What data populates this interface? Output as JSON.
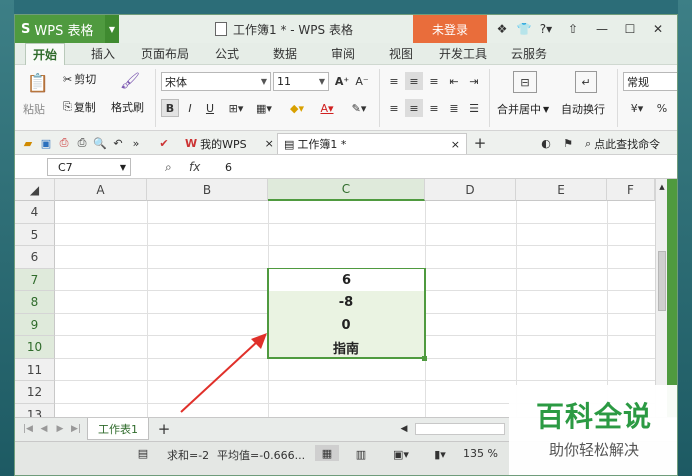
{
  "app": {
    "name": "WPS 表格",
    "logo": "S"
  },
  "title": "工作簿1 * - WPS 表格",
  "login": "未登录",
  "menu_tabs": [
    "开始",
    "插入",
    "页面布局",
    "公式",
    "数据",
    "审阅",
    "视图",
    "开发工具",
    "云服务"
  ],
  "ribbon": {
    "paste": "粘贴",
    "cut": "剪切",
    "copy": "复制",
    "format_painter": "格式刷",
    "font": "宋体",
    "font_size": "11",
    "merge_center": "合并居中",
    "wrap_text": "自动换行",
    "number_format": "常规",
    "percent": "%"
  },
  "doc_tabs": {
    "mywps": "我的WPS",
    "book": "工作簿1 *",
    "search": "点此查找命令"
  },
  "formula_bar": {
    "cell_ref": "C7",
    "fx": "fx",
    "value": "6"
  },
  "columns": [
    "A",
    "B",
    "C",
    "D",
    "E",
    "F"
  ],
  "rows": [
    "4",
    "5",
    "6",
    "7",
    "8",
    "9",
    "10",
    "11",
    "12",
    "13"
  ],
  "cells": {
    "c7": "6",
    "c8": "-8",
    "c9": "0",
    "c10": "指南"
  },
  "sheet_tab": "工作表1",
  "status": {
    "sum": "求和=-2",
    "avg": "平均值=-0.666...",
    "zoom": "135 %"
  },
  "watermark": {
    "title": "百科全说",
    "subtitle": "助你轻松解决"
  },
  "colors": {
    "accent": "#4f9a3f",
    "login": "#e96d3b",
    "arrow": "#e0302a",
    "watermark": "#2b9a43"
  }
}
